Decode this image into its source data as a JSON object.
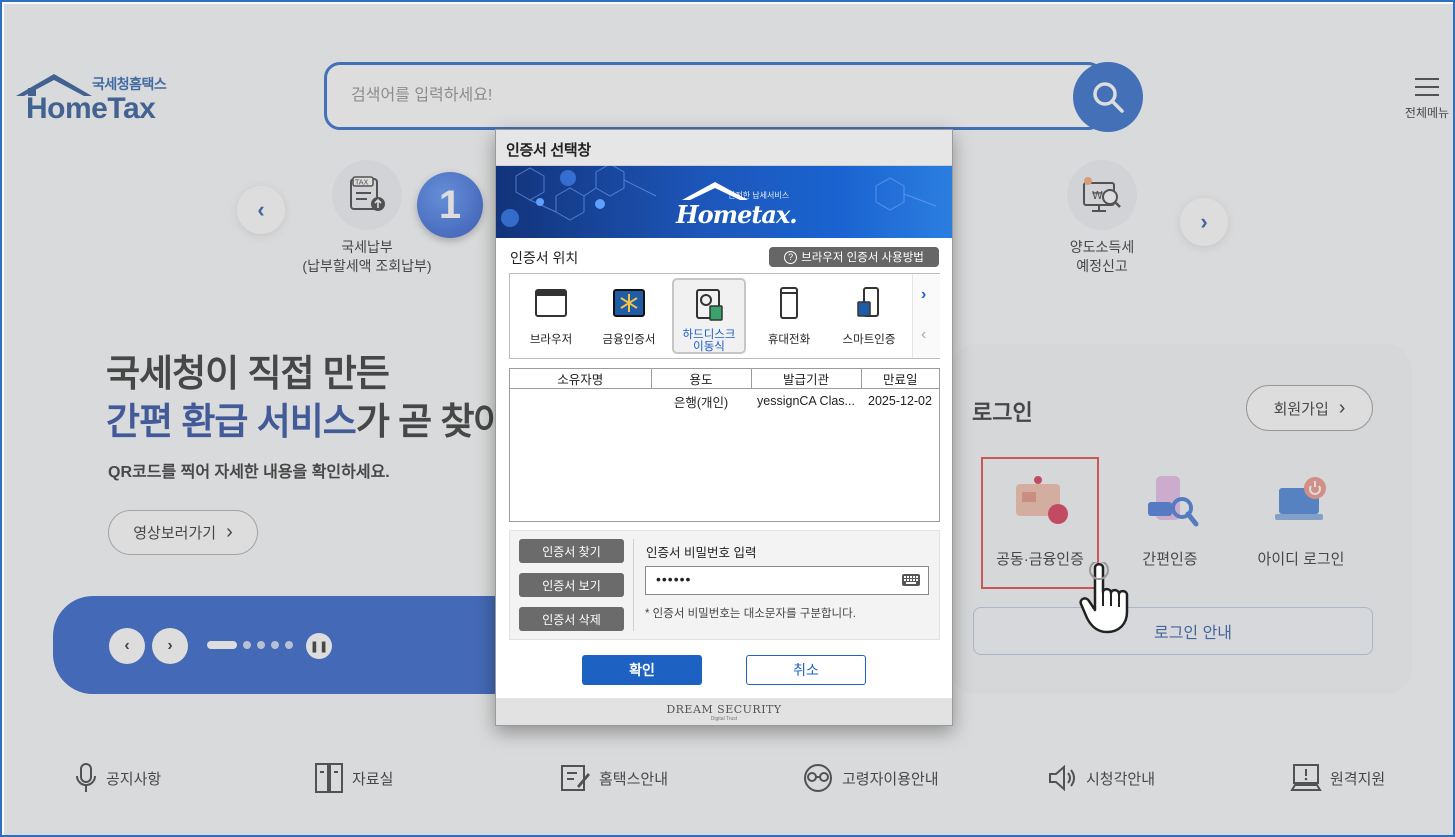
{
  "header": {
    "logo_small": "국세청홈택스",
    "logo_big": "HomeTax",
    "search_placeholder": "검색어를 입력하세요!",
    "menu_label": "전체메뉴"
  },
  "quick_menu": {
    "items": [
      {
        "line1": "국세납부",
        "line2": "(납부할세액 조회납부)",
        "icon": "tax-payment-icon"
      },
      {
        "line1": "양도소득세",
        "line2": "예정신고",
        "icon": "capital-gains-icon"
      }
    ],
    "step_badge": "1"
  },
  "banner": {
    "headline_line1": "국세청이 직접 만든",
    "headline_blue": "간편 환급 서비스",
    "headline_rest": "가 곧 찾아",
    "subline": "QR코드를 찍어 자세한 내용을 확인하세요.",
    "video_button": "영상보러가기",
    "prev_icon": "chevron-left-icon",
    "next_icon": "chevron-right-icon",
    "pause_icon": "pause-icon"
  },
  "login": {
    "title": "로그인",
    "join_button": "회원가입",
    "options": [
      {
        "label": "공동·금융인증",
        "icon": "certificate-icon"
      },
      {
        "label": "간편인증",
        "icon": "simple-auth-icon"
      },
      {
        "label": "아이디 로그인",
        "icon": "id-login-icon"
      }
    ],
    "guide_button": "로그인 안내"
  },
  "footer": {
    "items": [
      {
        "label": "공지사항",
        "icon": "microphone-icon"
      },
      {
        "label": "자료실",
        "icon": "archive-icon"
      },
      {
        "label": "홈택스안내",
        "icon": "guide-icon"
      },
      {
        "label": "고령자이용안내",
        "icon": "senior-icon"
      },
      {
        "label": "시청각안내",
        "icon": "speaker-icon"
      },
      {
        "label": "원격지원",
        "icon": "remote-support-icon"
      }
    ]
  },
  "dialog": {
    "title": "인증서 선택창",
    "banner_small": "안전한 납세서비스",
    "banner_brand": "Hometax.",
    "location_label": "인증서 위치",
    "help_button": "브라우저 인증서 사용방법",
    "storage": [
      {
        "label": "브라우저",
        "icon": "browser-icon"
      },
      {
        "label": "금융인증서",
        "icon": "financial-cert-icon"
      },
      {
        "label_line1": "하드디스크",
        "label_line2": "이동식",
        "icon": "harddisk-icon",
        "selected": true
      },
      {
        "label": "휴대전화",
        "icon": "phone-icon"
      },
      {
        "label": "스마트인증",
        "icon": "smart-auth-icon"
      }
    ],
    "table": {
      "headers": [
        "소유자명",
        "용도",
        "발급기관",
        "만료일"
      ],
      "rows": [
        [
          "",
          "은행(개인)",
          "yessignCA Clas...",
          "2025-12-02"
        ]
      ]
    },
    "buttons": {
      "find": "인증서 찾기",
      "view": "인증서 보기",
      "delete": "인증서 삭제",
      "ok": "확인",
      "cancel": "취소"
    },
    "password_label": "인증서 비밀번호 입력",
    "password_value": "••••••",
    "password_note": "* 인증서 비밀번호는 대소문자를 구분합니다.",
    "footer_brand": "DREAM SECURITY",
    "footer_tag": "Digital Trust"
  },
  "colors": {
    "brand_blue": "#1d5fc8",
    "highlight_red": "#e03a3a",
    "dialog_button_gray": "#6b6b6b"
  }
}
